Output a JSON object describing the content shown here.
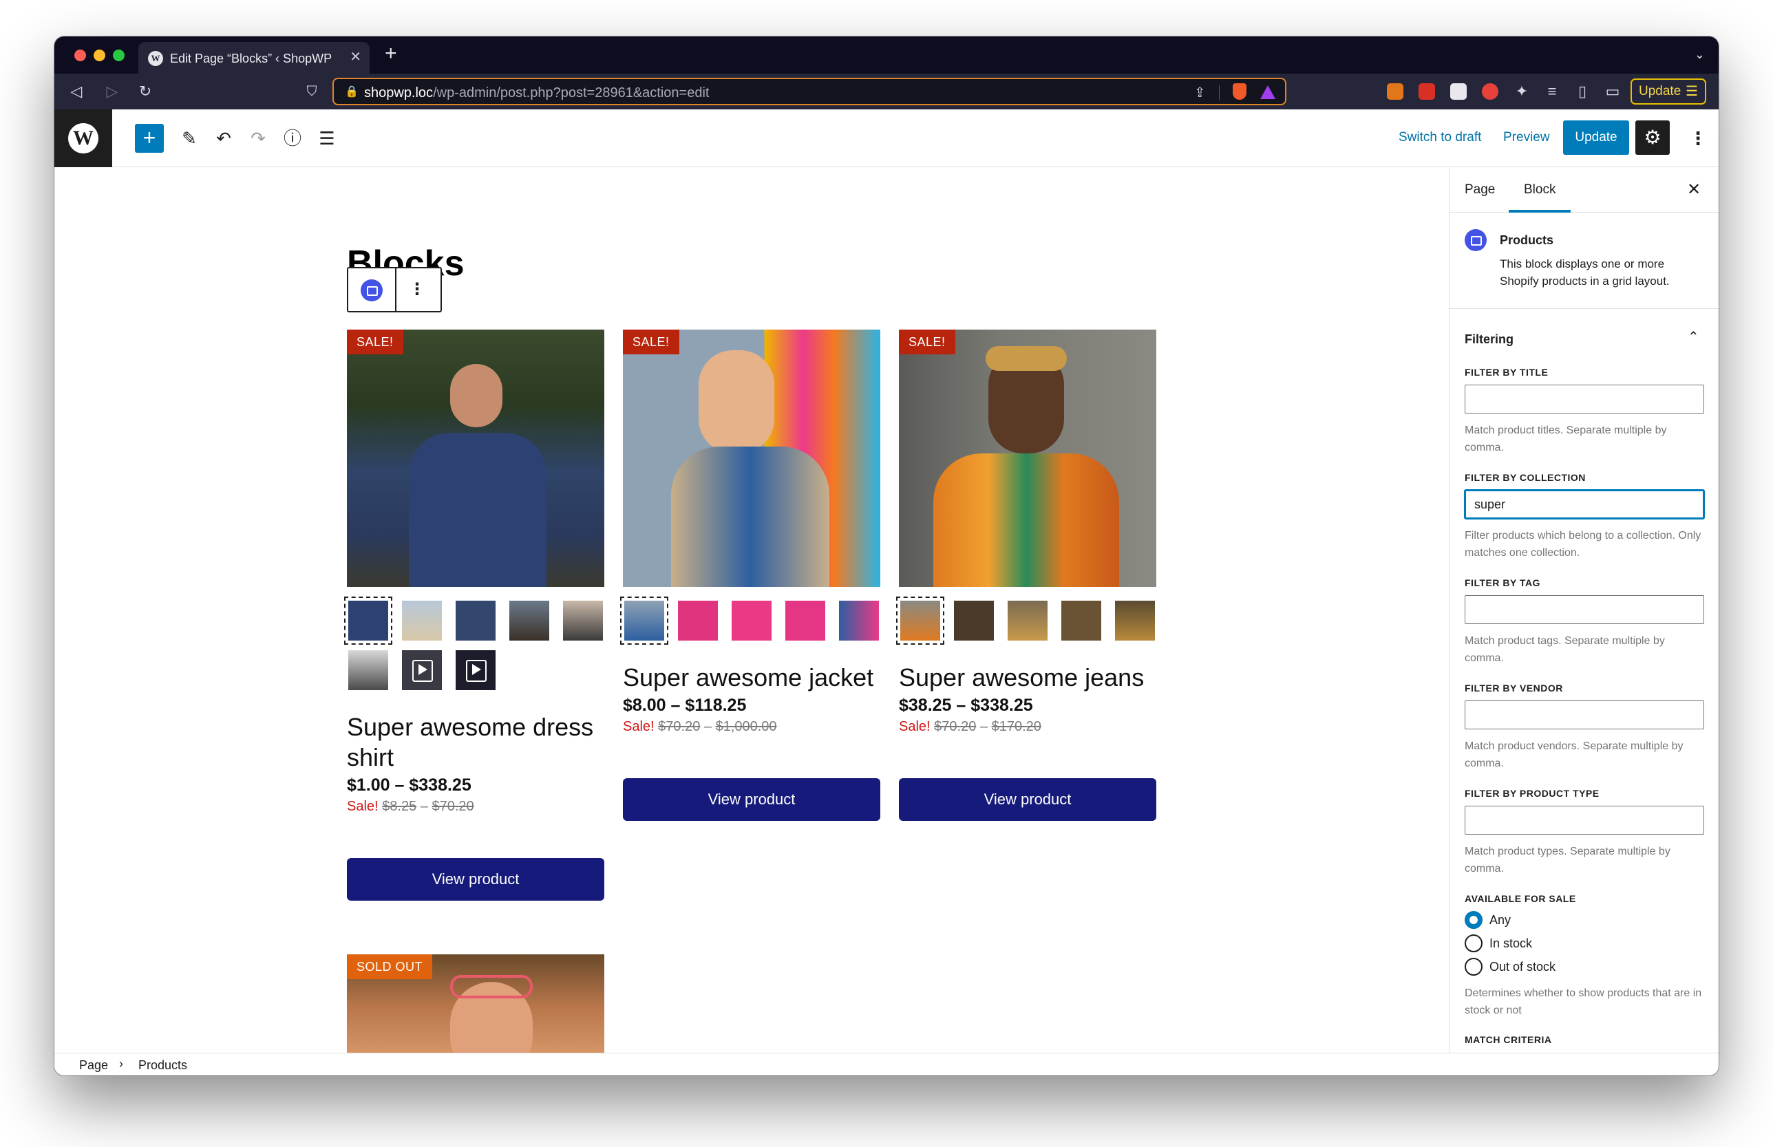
{
  "browser": {
    "tab_title": "Edit Page “Blocks” ‹ ShopWP S",
    "url_host": "shopwp.loc",
    "url_path": "/wp-admin/post.php?post=28961&action=edit",
    "update_label": "Update"
  },
  "editor": {
    "switch_to_draft": "Switch to draft",
    "preview": "Preview",
    "update": "Update"
  },
  "page": {
    "title": "Blocks"
  },
  "products": [
    {
      "badge": "SALE!",
      "title": "Super awesome dress shirt",
      "price": "$1.00 – $338.25",
      "sale_word": "Sale!",
      "old_low": "$8.25",
      "old_high": "$70.20",
      "button": "View product"
    },
    {
      "badge": "SALE!",
      "title": "Super awesome jacket",
      "price": "$8.00 – $118.25",
      "sale_word": "Sale!",
      "old_low": "$70.20",
      "old_high": "$1,000.00",
      "button": "View product"
    },
    {
      "badge": "SALE!",
      "title": "Super awesome jeans",
      "price": "$38.25 – $338.25",
      "sale_word": "Sale!",
      "old_low": "$70.20",
      "old_high": "$170.20",
      "button": "View product"
    },
    {
      "badge": "SOLD OUT"
    }
  ],
  "breadcrumb": {
    "items": [
      "Page",
      "Products"
    ]
  },
  "sidebar": {
    "tabs": [
      "Page",
      "Block"
    ],
    "block_name": "Products",
    "block_description": "This block displays one or more Shopify products in a grid layout.",
    "section": "Filtering",
    "fields": [
      {
        "label": "FILTER BY TITLE",
        "value": "",
        "help": "Match product titles. Separate multiple by comma."
      },
      {
        "label": "FILTER BY COLLECTION",
        "value": "super",
        "help": "Filter products which belong to a collection. Only matches one collection."
      },
      {
        "label": "FILTER BY TAG",
        "value": "",
        "help": "Match product tags. Separate multiple by comma."
      },
      {
        "label": "FILTER BY VENDOR",
        "value": "",
        "help": "Match product vendors. Separate multiple by comma."
      },
      {
        "label": "FILTER BY PRODUCT TYPE",
        "value": "",
        "help": "Match product types. Separate multiple by comma."
      }
    ],
    "available_label": "AVAILABLE FOR SALE",
    "available_options": [
      "Any",
      "In stock",
      "Out of stock"
    ],
    "available_selected": "Any",
    "available_help": "Determines whether to show products that are in stock or not",
    "match_criteria": "MATCH CRITERIA"
  },
  "colors": {
    "wp_blue": "#007cba",
    "button_navy": "#151a7b",
    "sale_red": "#d01616",
    "badge_red": "#b8240c",
    "badge_orange": "#e0620d",
    "shopwp_icon": "#4353e5"
  }
}
